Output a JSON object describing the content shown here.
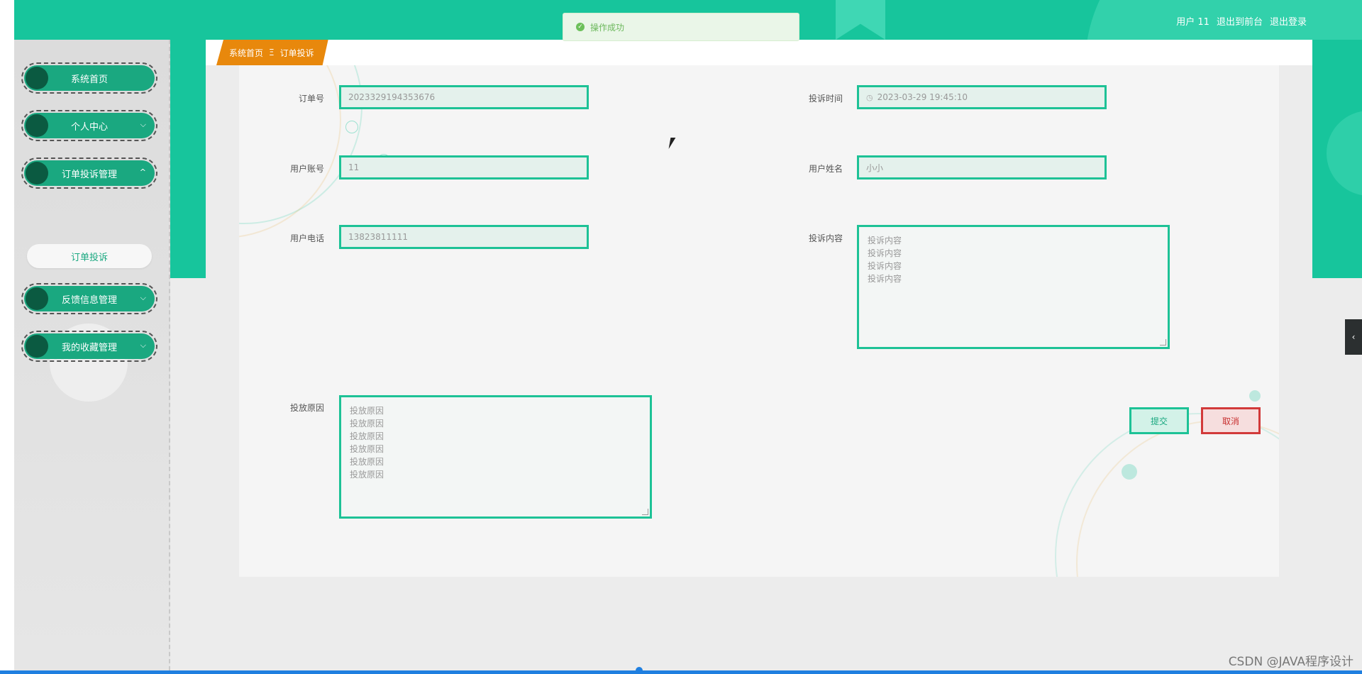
{
  "header": {
    "user_label": "用户 11",
    "front_link": "退出到前台",
    "logout_link": "退出登录"
  },
  "toast": {
    "message": "操作成功"
  },
  "sidebar": {
    "items": [
      {
        "label": "系统首页"
      },
      {
        "label": "个人中心"
      },
      {
        "label": "订单投诉管理"
      },
      {
        "label": "反馈信息管理"
      },
      {
        "label": "我的收藏管理"
      }
    ],
    "sub_item": "订单投诉"
  },
  "breadcrumb": {
    "home": "系统首页",
    "separator": "Ξ",
    "current": "订单投诉"
  },
  "form": {
    "order_no_label": "订单号",
    "order_no_value": "2023329194353676",
    "complaint_time_label": "投诉时间",
    "complaint_time_value": "2023-03-29 19:45:10",
    "account_label": "用户账号",
    "account_value": "11",
    "name_label": "用户姓名",
    "name_value": "小小",
    "phone_label": "用户电话",
    "phone_value": "13823811111",
    "content_label": "投诉内容",
    "content_lines": [
      "投诉内容",
      "投诉内容",
      "投诉内容",
      "投诉内容"
    ],
    "reason_label": "投放原因",
    "reason_lines": [
      "投放原因",
      "投放原因",
      "投放原因",
      "投放原因",
      "投放原因",
      "投放原因"
    ],
    "submit_label": "提交",
    "cancel_label": "取消"
  },
  "watermark": "CSDN @JAVA程序设计",
  "colors": {
    "primary": "#17c59c",
    "accent": "#e8880c",
    "danger": "#d23a3a"
  }
}
